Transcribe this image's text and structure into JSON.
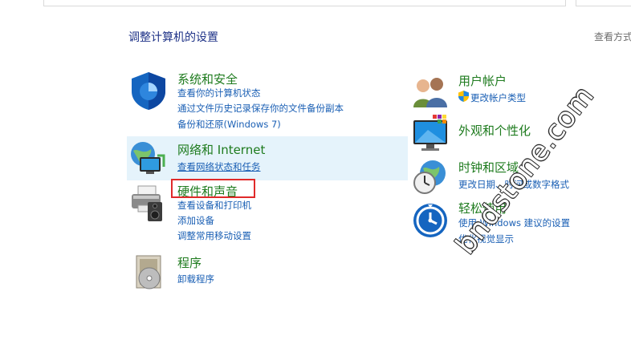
{
  "page": {
    "title": "调整计算机的设置",
    "view_by": "查看方式"
  },
  "left": [
    {
      "title": "系统和安全",
      "links": [
        "查看你的计算机状态",
        "通过文件历史记录保存你的文件备份副本",
        "备份和还原(Windows 7)"
      ],
      "icon": "shield-icon"
    },
    {
      "title": "网络和 Internet",
      "links": [
        "查看网络状态和任务"
      ],
      "icon": "network-globe-icon"
    },
    {
      "title": "硬件和声音",
      "links": [
        "查看设备和打印机",
        "添加设备",
        "调整常用移动设置"
      ],
      "icon": "printer-speaker-icon"
    },
    {
      "title": "程序",
      "links": [
        "卸载程序"
      ],
      "icon": "programs-disc-icon"
    }
  ],
  "right": [
    {
      "title": "用户帐户",
      "links": [
        "更改帐户类型"
      ],
      "icon": "users-icon"
    },
    {
      "title": "外观和个性化",
      "links": [],
      "icon": "monitor-palette-icon"
    },
    {
      "title": "时钟和区域",
      "links": [
        "更改日期、时间或数字格式"
      ],
      "icon": "clock-globe-icon"
    },
    {
      "title": "轻松使用",
      "links": [
        "使用 Windows 建议的设置",
        "优化视觉显示"
      ],
      "icon": "ease-of-access-icon"
    }
  ],
  "watermark": "bndstone.com",
  "colors": {
    "title_green": "#1e7b1e",
    "link_blue": "#1a5fb4",
    "hover_bg": "#e5f3fb",
    "highlight_red": "#e02a2a"
  }
}
